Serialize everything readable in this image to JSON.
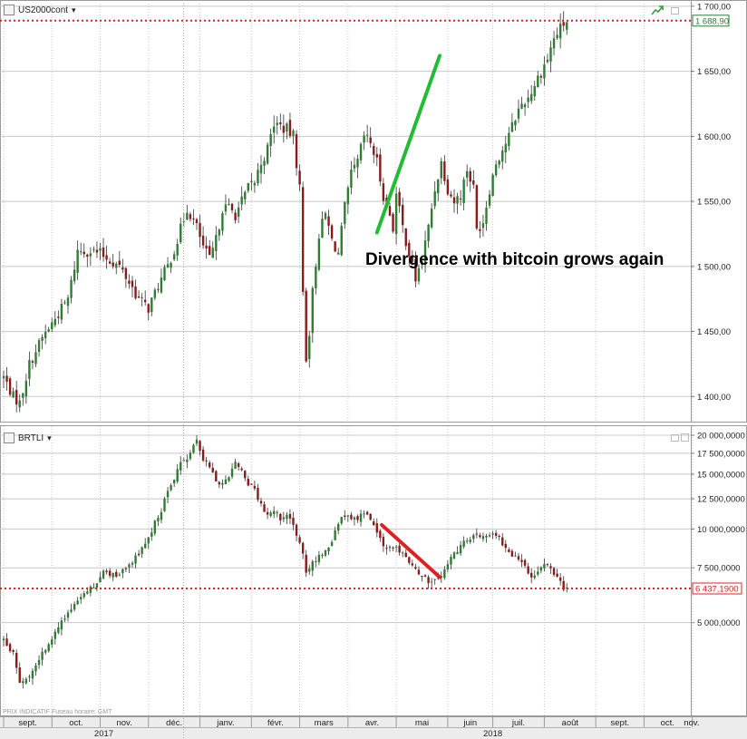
{
  "panels": {
    "top": {
      "instrument": "US2000cont",
      "caret": "▾"
    },
    "bottom": {
      "instrument": "BRTLI",
      "caret": "▾"
    }
  },
  "footer": {
    "note": "PRIX INDICATIF   Fuseau horaire: GMT"
  },
  "colors": {
    "grid": "#c8c8c8",
    "candle_up": "#2e7d32",
    "candle_down": "#8b1a1a",
    "hline": "#e02020",
    "trend_up": "#22bb33",
    "trend_down": "#e02020",
    "price_box_top": "#2e7d32",
    "price_box_bottom": "#e02020"
  },
  "chart_data": [
    {
      "type": "candlestick",
      "instrument": "US2000cont",
      "ylim": [
        1380,
        1702
      ],
      "y_ticks": [
        1400,
        1450,
        1500,
        1550,
        1600,
        1650,
        1700
      ],
      "y_tick_labels": [
        "1 400,00",
        "1 450,00",
        "1 500,00",
        "1 550,00",
        "1 600,00",
        "1 650,00",
        "1 700,00"
      ],
      "last_price": 1688.9,
      "last_price_label": "1 688,90",
      "close_path": [
        [
          0,
          1415
        ],
        [
          3,
          1400
        ],
        [
          5,
          1395
        ],
        [
          8,
          1425
        ],
        [
          12,
          1445
        ],
        [
          16,
          1460
        ],
        [
          20,
          1475
        ],
        [
          23,
          1512
        ],
        [
          27,
          1512
        ],
        [
          30,
          1510
        ],
        [
          33,
          1505
        ],
        [
          36,
          1500
        ],
        [
          39,
          1488
        ],
        [
          42,
          1475
        ],
        [
          45,
          1468
        ],
        [
          48,
          1485
        ],
        [
          51,
          1500
        ],
        [
          54,
          1520
        ],
        [
          57,
          1545
        ],
        [
          60,
          1530
        ],
        [
          62,
          1515
        ],
        [
          64,
          1505
        ],
        [
          66,
          1520
        ],
        [
          68,
          1545
        ],
        [
          70,
          1545
        ],
        [
          72,
          1540
        ],
        [
          74,
          1550
        ],
        [
          76,
          1560
        ],
        [
          78,
          1565
        ],
        [
          80,
          1580
        ],
        [
          82,
          1590
        ],
        [
          84,
          1610
        ],
        [
          86,
          1608
        ],
        [
          88,
          1605
        ],
        [
          90,
          1600
        ],
        [
          92,
          1560
        ],
        [
          93,
          1480
        ],
        [
          94,
          1430
        ],
        [
          95,
          1450
        ],
        [
          96,
          1480
        ],
        [
          98,
          1525
        ],
        [
          100,
          1540
        ],
        [
          102,
          1520
        ],
        [
          104,
          1510
        ],
        [
          106,
          1545
        ],
        [
          108,
          1570
        ],
        [
          110,
          1580
        ],
        [
          112,
          1600
        ],
        [
          114,
          1595
        ],
        [
          116,
          1580
        ],
        [
          118,
          1555
        ],
        [
          120,
          1540
        ],
        [
          121,
          1530
        ],
        [
          122,
          1555
        ],
        [
          124,
          1530
        ],
        [
          126,
          1510
        ],
        [
          128,
          1490
        ],
        [
          130,
          1505
        ],
        [
          132,
          1530
        ],
        [
          134,
          1560
        ],
        [
          136,
          1580
        ],
        [
          138,
          1560
        ],
        [
          140,
          1550
        ],
        [
          142,
          1555
        ],
        [
          144,
          1575
        ],
        [
          146,
          1560
        ],
        [
          147,
          1528
        ],
        [
          149,
          1535
        ],
        [
          151,
          1560
        ],
        [
          153,
          1580
        ],
        [
          155,
          1590
        ],
        [
          157,
          1600
        ],
        [
          159,
          1615
        ],
        [
          161,
          1625
        ],
        [
          163,
          1630
        ],
        [
          165,
          1640
        ],
        [
          167,
          1650
        ],
        [
          169,
          1660
        ],
        [
          171,
          1675
        ],
        [
          173,
          1683
        ],
        [
          175,
          1689
        ]
      ]
    },
    {
      "type": "candlestick",
      "instrument": "BRTLI",
      "y_ticks": [
        5000000,
        7500000,
        10000000,
        12500000,
        15000000,
        17500000,
        20000000
      ],
      "y_tick_labels": [
        "5 000,0000",
        "7 500,0000",
        "10 000,0000",
        "12 500,0000",
        "15 000,0000",
        "17 500,0000",
        "20 000,0000"
      ],
      "y_range_min": 2500000,
      "y_range_max": 20000000,
      "y_scale": "logarithmic",
      "last_price": 6437.19,
      "last_price_label": "6 437,1900",
      "close_path": [
        [
          0,
          4400000
        ],
        [
          3,
          4000000
        ],
        [
          5,
          3200000
        ],
        [
          8,
          3400000
        ],
        [
          12,
          4000000
        ],
        [
          16,
          4600000
        ],
        [
          20,
          5400000
        ],
        [
          24,
          6100000
        ],
        [
          28,
          6600000
        ],
        [
          32,
          7400000
        ],
        [
          35,
          6900000
        ],
        [
          38,
          7500000
        ],
        [
          42,
          8300000
        ],
        [
          46,
          9800000
        ],
        [
          49,
          11500000
        ],
        [
          52,
          14000000
        ],
        [
          55,
          16000000
        ],
        [
          58,
          17500000
        ],
        [
          60,
          19200000
        ],
        [
          62,
          17000000
        ],
        [
          64,
          15500000
        ],
        [
          66,
          14500000
        ],
        [
          68,
          14000000
        ],
        [
          70,
          15000000
        ],
        [
          72,
          16300000
        ],
        [
          74,
          15400000
        ],
        [
          76,
          14000000
        ],
        [
          78,
          13300000
        ],
        [
          80,
          12000000
        ],
        [
          82,
          11000000
        ],
        [
          84,
          11300000
        ],
        [
          86,
          10800000
        ],
        [
          88,
          11000000
        ],
        [
          90,
          10200000
        ],
        [
          92,
          9000000
        ],
        [
          94,
          7300000
        ],
        [
          96,
          7700000
        ],
        [
          98,
          8200000
        ],
        [
          100,
          8600000
        ],
        [
          102,
          9200000
        ],
        [
          104,
          10300000
        ],
        [
          106,
          11200000
        ],
        [
          108,
          11000000
        ],
        [
          110,
          10800000
        ],
        [
          112,
          11400000
        ],
        [
          114,
          10800000
        ],
        [
          116,
          9500000
        ],
        [
          118,
          9000000
        ],
        [
          120,
          8700000
        ],
        [
          122,
          8600000
        ],
        [
          124,
          8300000
        ],
        [
          126,
          7700000
        ],
        [
          128,
          7300000
        ],
        [
          130,
          7200000
        ],
        [
          132,
          6800000
        ],
        [
          134,
          6800000
        ],
        [
          136,
          6900000
        ],
        [
          138,
          7600000
        ],
        [
          140,
          8300000
        ],
        [
          142,
          8800000
        ],
        [
          144,
          9300000
        ],
        [
          146,
          9600000
        ],
        [
          148,
          9500000
        ],
        [
          150,
          9600000
        ],
        [
          152,
          9800000
        ],
        [
          154,
          9300000
        ],
        [
          156,
          8700000
        ],
        [
          158,
          8300000
        ],
        [
          160,
          7900000
        ],
        [
          162,
          7500000
        ],
        [
          164,
          7100000
        ],
        [
          166,
          7400000
        ],
        [
          168,
          7700000
        ],
        [
          170,
          7600000
        ],
        [
          172,
          7000000
        ],
        [
          174,
          6500000
        ],
        [
          175,
          6437190
        ]
      ]
    }
  ],
  "x_axis": {
    "months": [
      {
        "label": "sept.",
        "day": 0
      },
      {
        "label": "oct.",
        "day": 15
      },
      {
        "label": "nov.",
        "day": 30
      },
      {
        "label": "déc.",
        "day": 45
      },
      {
        "label": "janv.",
        "day": 61
      },
      {
        "label": "févr.",
        "day": 77
      },
      {
        "label": "mars",
        "day": 92
      },
      {
        "label": "avr.",
        "day": 107
      },
      {
        "label": "mai",
        "day": 122
      },
      {
        "label": "juin",
        "day": 138
      },
      {
        "label": "juil.",
        "day": 152
      },
      {
        "label": "août",
        "day": 168
      },
      {
        "label": "sept.",
        "day": 184
      },
      {
        "label": "oct.",
        "day": 199
      },
      {
        "label": "nov.",
        "day": 214
      }
    ],
    "years": [
      {
        "label": "2017",
        "day": 30
      },
      {
        "label": "2018",
        "day": 152
      }
    ]
  },
  "annotations": {
    "divergence_text": "Divergence with bitcoin grows again"
  }
}
